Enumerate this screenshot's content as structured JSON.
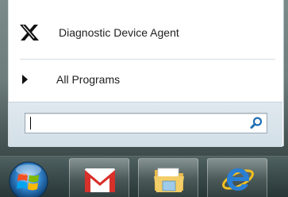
{
  "start_menu": {
    "pinned_app": {
      "label": "Diagnostic Device Agent",
      "icon": "x-logo-icon"
    },
    "all_programs": {
      "label": "All Programs",
      "icon": "triangle-right-icon"
    },
    "search": {
      "value": "",
      "placeholder": "",
      "icon": "magnifier-icon"
    }
  },
  "taskbar": {
    "start_button": {
      "icon": "windows-orb-icon"
    },
    "items": [
      {
        "icon": "gmail-icon"
      },
      {
        "icon": "folder-icon"
      },
      {
        "icon": "internet-explorer-icon"
      }
    ]
  },
  "colors": {
    "menu_background": "#ffffff",
    "search_zone": "#d7e2ea",
    "search_icon": "#1f6fb5",
    "gmail_red": "#d8302a",
    "ie_blue": "#2a7fd4"
  }
}
